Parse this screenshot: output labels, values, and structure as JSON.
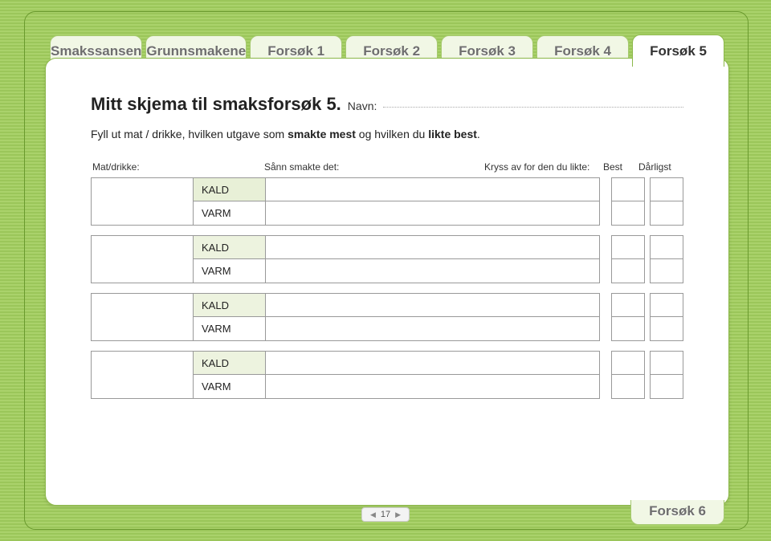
{
  "tabs": [
    {
      "label": "Smakssansen"
    },
    {
      "label": "Grunnsmakene"
    },
    {
      "label": "Forsøk 1"
    },
    {
      "label": "Forsøk 2"
    },
    {
      "label": "Forsøk 3"
    },
    {
      "label": "Forsøk 4"
    },
    {
      "label": "Forsøk 5"
    }
  ],
  "active_tab": 6,
  "title": "Mitt skjema til smaksforsøk 5.",
  "navn_label": "Navn:",
  "instruction_pre": "Fyll ut mat / drikke, hvilken utgave som ",
  "instruction_b1": "smakte mest",
  "instruction_mid": " og hvilken du ",
  "instruction_b2": "likte best",
  "instruction_post": ".",
  "headers": {
    "food": "Mat/drikke:",
    "taste": "Sånn smakte det:",
    "check": "Kryss av for den du likte:",
    "best": "Best",
    "worst": "Dårligst"
  },
  "temps": {
    "kald": "KALD",
    "varm": "VARM"
  },
  "group_count": 4,
  "footer_tab": "Forsøk 6",
  "page_number": "17"
}
